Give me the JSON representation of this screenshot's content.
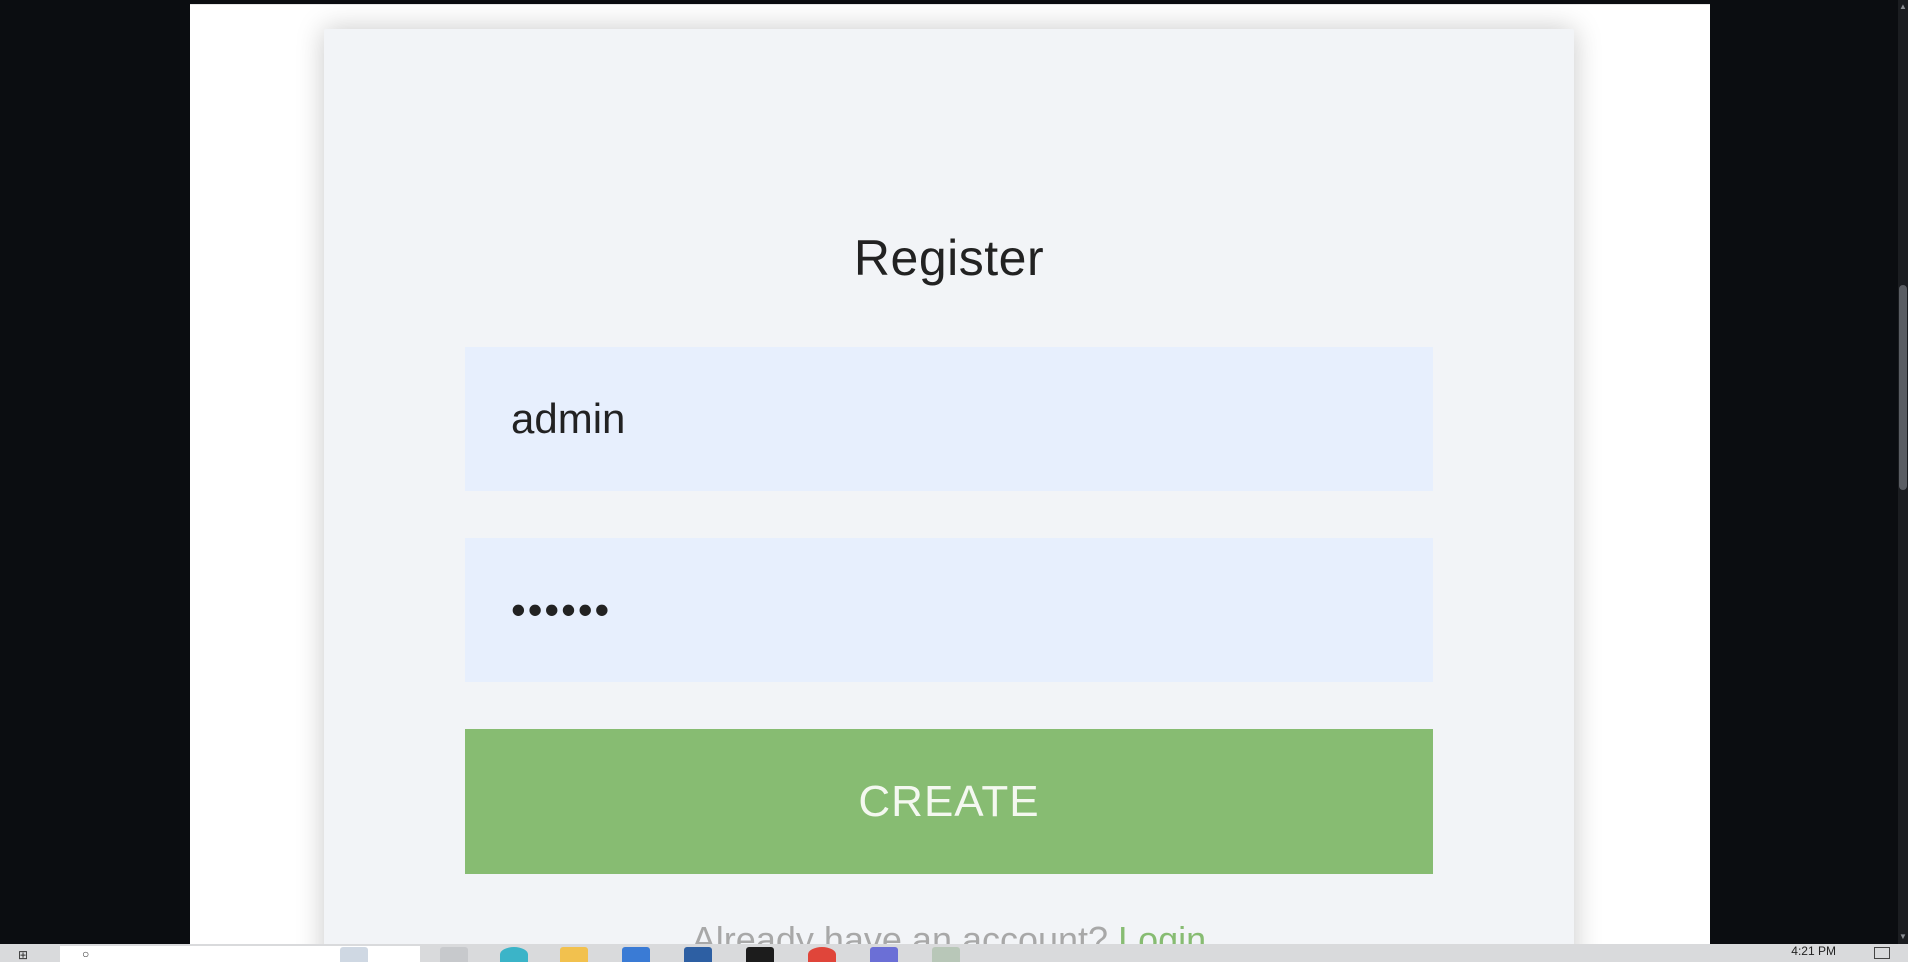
{
  "form": {
    "title": "Register",
    "username_value": "admin",
    "password_value": "••••••",
    "submit_label": "CREATE",
    "footer_prefix": "Already have an account?",
    "footer_link": "Login"
  },
  "taskbar": {
    "clock": "4:21 PM",
    "icons": [
      "start-icon",
      "search-icon",
      "task-view-icon",
      "edge-icon",
      "file-explorer-icon",
      "store-icon",
      "app-icon",
      "terminal-icon",
      "chrome-icon",
      "vscode-icon",
      "notepad-icon"
    ]
  },
  "colors": {
    "accent_green": "#87bc72",
    "input_bg": "#e7effd",
    "card_bg": "#f2f4f7",
    "side_bg": "#0b0d11"
  }
}
